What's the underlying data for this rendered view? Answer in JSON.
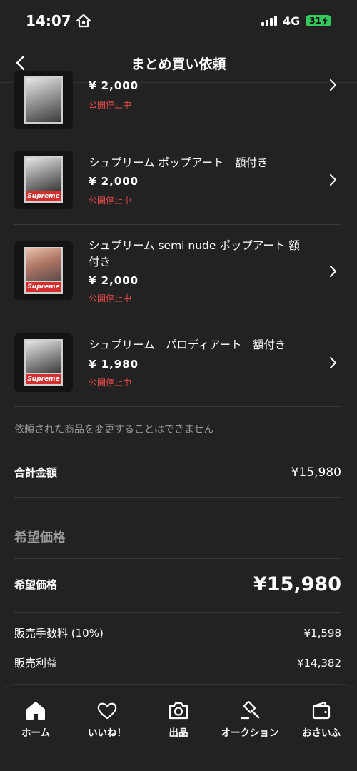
{
  "status_bar": {
    "time": "14:07",
    "network": "4G",
    "battery": "31"
  },
  "header": {
    "title": "まとめ買い依頼"
  },
  "items": [
    {
      "title": "",
      "price": "¥ 2,000",
      "status": "公開停止中"
    },
    {
      "title": "シュプリーム ポップアート　額付き",
      "price": "¥ 2,000",
      "status": "公開停止中"
    },
    {
      "title": "シュプリーム semi nude ポップアート 額付き",
      "price": "¥ 2,000",
      "status": "公開停止中"
    },
    {
      "title": "シュプリーム　パロディアート　額付き",
      "price": "¥ 1,980",
      "status": "公開停止中"
    }
  ],
  "note": "依頼された商品を変更することはできません",
  "total": {
    "label": "合計金額",
    "value": "¥15,980"
  },
  "desired_section_title": "希望価格",
  "desired": {
    "label": "希望価格",
    "value": "¥15,980"
  },
  "fee": {
    "label": "販売手数料 (10%)",
    "value": "¥1,598"
  },
  "profit": {
    "label": "販売利益",
    "value": "¥14,382"
  },
  "tabs": [
    {
      "label": "ホーム",
      "icon": "home-icon"
    },
    {
      "label": "いいね！",
      "icon": "heart-icon"
    },
    {
      "label": "出品",
      "icon": "camera-icon"
    },
    {
      "label": "オークション",
      "icon": "gavel-icon"
    },
    {
      "label": "おさいふ",
      "icon": "wallet-icon"
    }
  ],
  "colors": {
    "background": "#222222",
    "status_red": "#e74c4c",
    "battery_green": "#34c759"
  }
}
